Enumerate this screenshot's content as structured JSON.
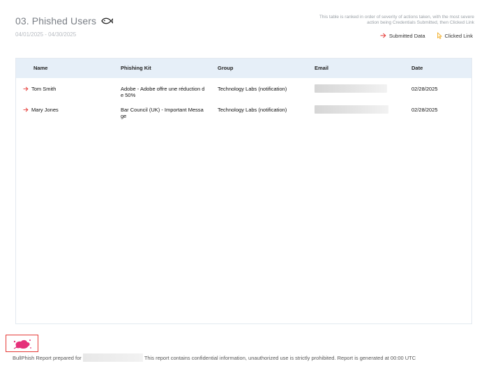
{
  "header": {
    "title": "03. Phished Users",
    "date_range": "04/01/2025 - 04/30/2025",
    "note_line1": "This table is ranked in order of severity of actions taken, with the most severe",
    "note_line2": "action being Credentials Submitted, then Clicked Link"
  },
  "legend": {
    "submitted_label": "Submitted Data",
    "clicked_label": "Clicked Link"
  },
  "table": {
    "columns": [
      "Name",
      "Phishing Kit",
      "Group",
      "Email",
      "Date"
    ],
    "rows": [
      {
        "name": "Tom Smith",
        "kit_line1": "Adobe - Adobe offre une réduction d",
        "kit_line2": "e 50%",
        "group": "Technology Labs (notification)",
        "date": "02/28/2025"
      },
      {
        "name": "Mary Jones",
        "kit_line1": "Bar Council (UK) - Important Messa",
        "kit_line2": "ge",
        "group": "Technology Labs (notification)",
        "date": "02/28/2025"
      }
    ]
  },
  "footer": {
    "prepared_for": "BullPhish Report prepared for",
    "disclaimer": "This report contains confidential information, unauthorized use is strictly prohibited. Report is generated at 00:00 UTC"
  },
  "colors": {
    "accent_red": "#e53935",
    "clicked_yellow": "#f2b134",
    "header_bg": "#e6eff8"
  }
}
